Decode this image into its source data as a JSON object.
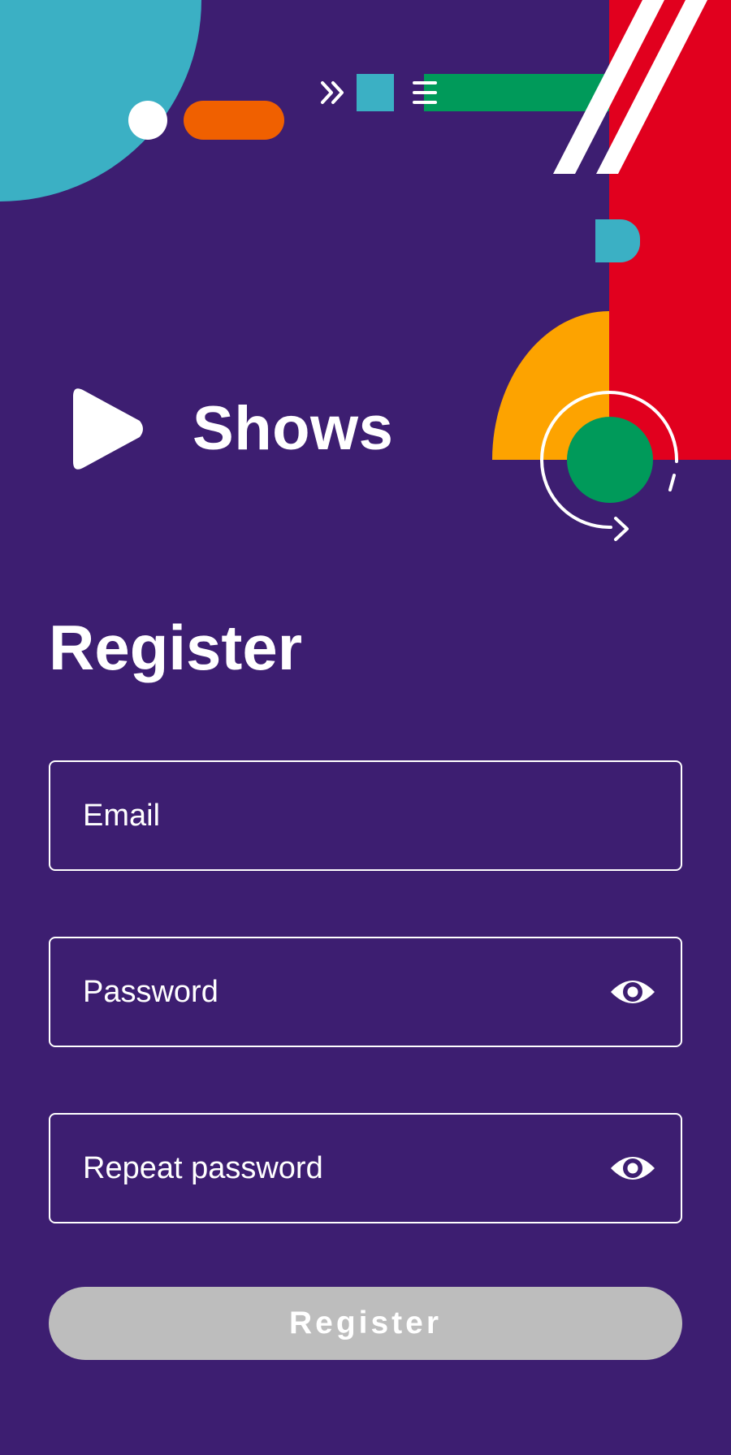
{
  "brand": {
    "name": "Shows"
  },
  "form": {
    "title": "Register",
    "email_placeholder": "Email",
    "password_placeholder": "Password",
    "repeat_password_placeholder": "Repeat password",
    "submit_label": "Register"
  },
  "colors": {
    "background": "#3d1e71",
    "teal": "#3bb0c4",
    "orange": "#f06000",
    "green": "#009a5a",
    "red": "#e1001e",
    "yellow": "#fda300",
    "button_disabled": "#bdbdbd"
  },
  "icons": {
    "logo": "play-icon",
    "password_toggle": "eye-icon",
    "repeat_password_toggle": "eye-icon"
  }
}
